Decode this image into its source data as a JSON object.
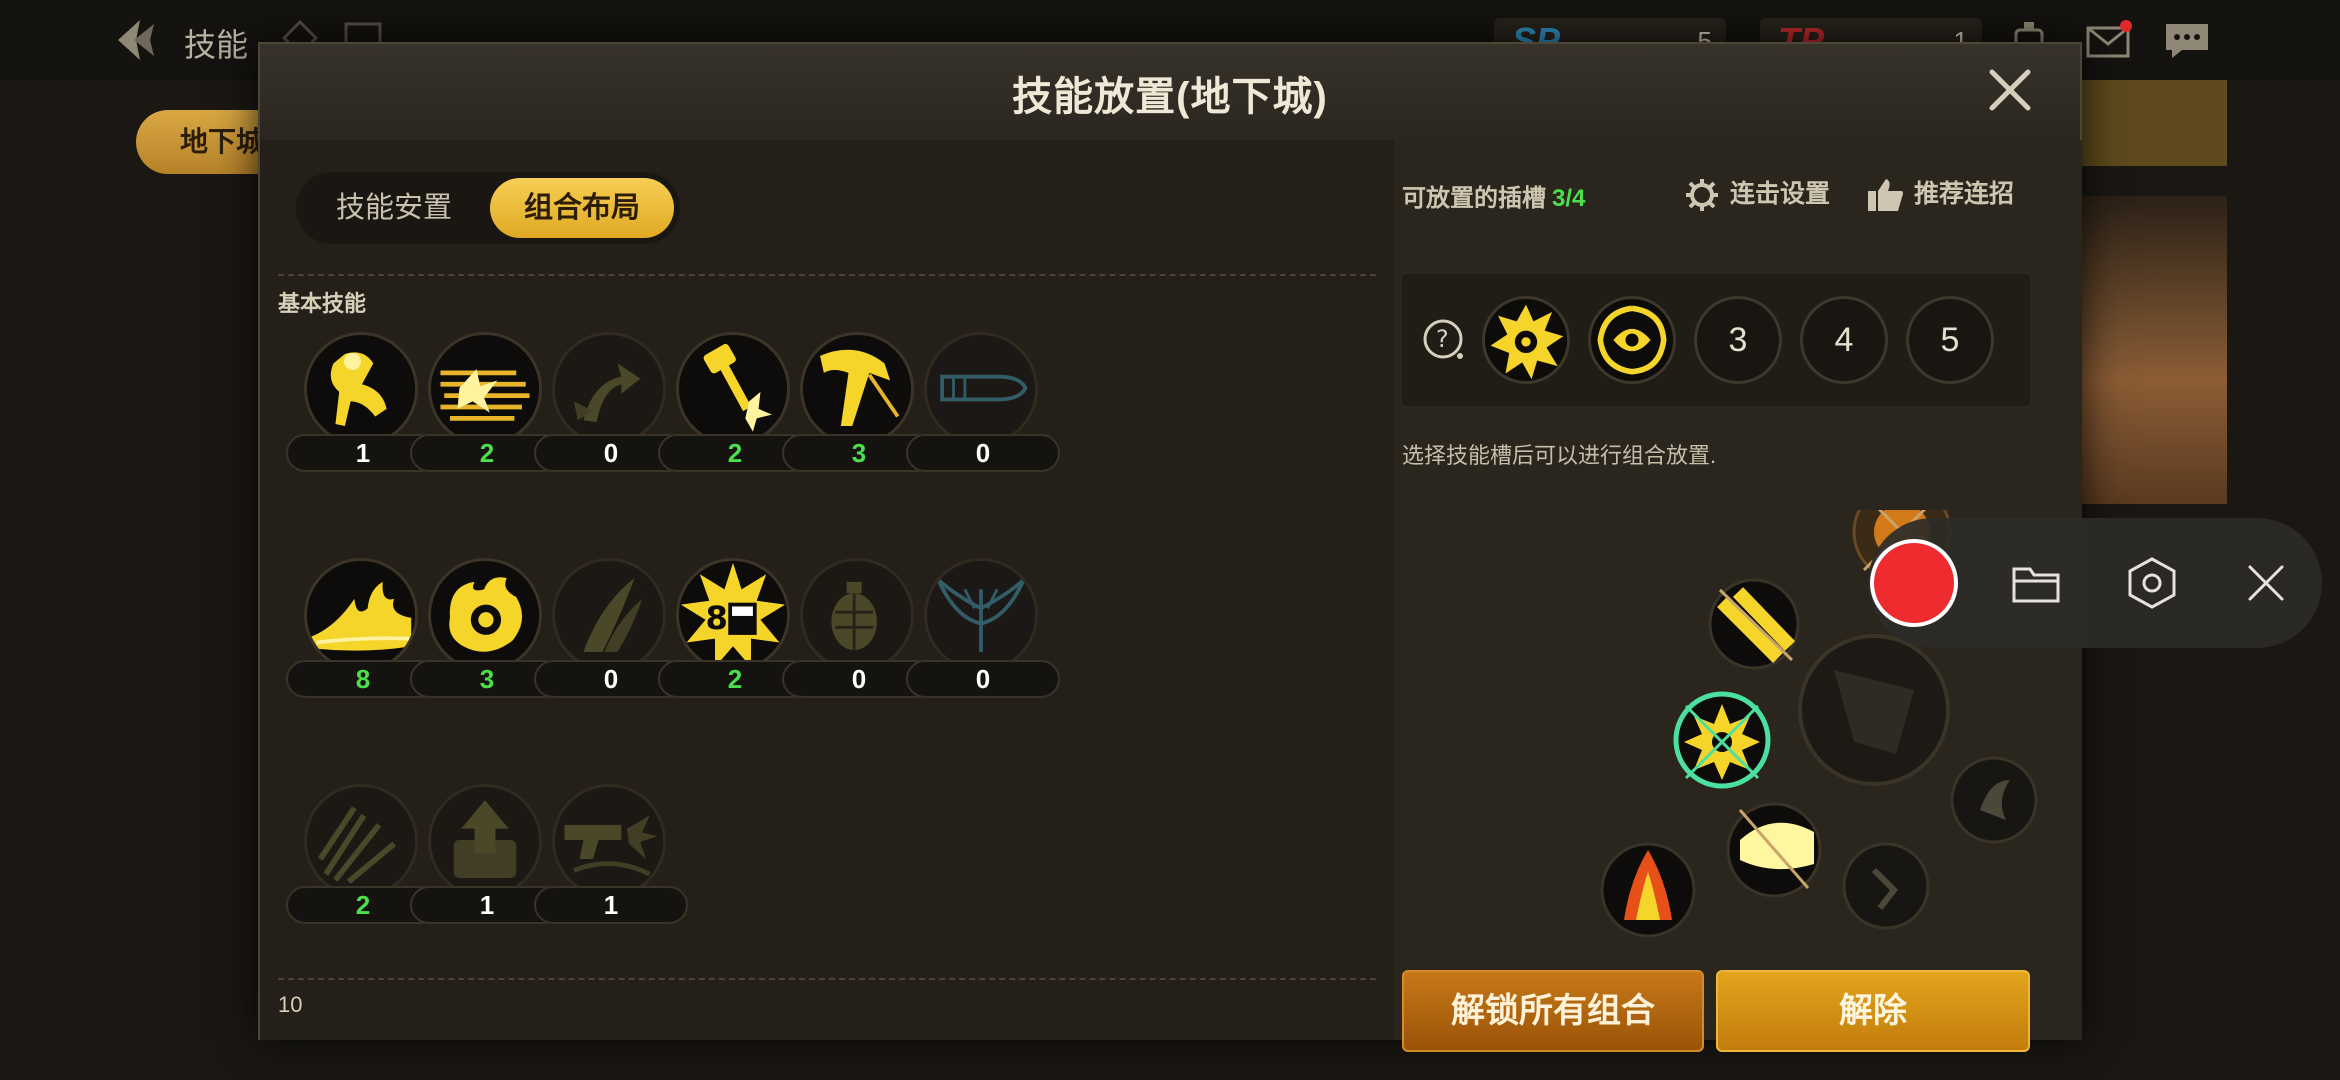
{
  "background": {
    "page_title": "技能",
    "tab_label": "地下城",
    "sp": {
      "label": "SP",
      "value": "5"
    },
    "tp": {
      "label": "TP",
      "value": "1"
    }
  },
  "dialog": {
    "title": "技能放置(地下城)",
    "tabs": [
      {
        "label": "技能安置",
        "active": false
      },
      {
        "label": "组合布局",
        "active": true
      }
    ],
    "section_label": "基本技能",
    "footer_number": "10",
    "skills": [
      {
        "count": "1",
        "count_color": "white",
        "icon": "kick-skill-icon",
        "active": true
      },
      {
        "count": "2",
        "count_color": "green",
        "icon": "dash-burst-icon",
        "active": true
      },
      {
        "count": "0",
        "count_color": "white",
        "icon": "uppercut-arrow-icon",
        "active": false
      },
      {
        "count": "2",
        "count_color": "green",
        "icon": "hammer-strike-icon",
        "active": true
      },
      {
        "count": "3",
        "count_color": "green",
        "icon": "leg-kick-icon",
        "active": true
      },
      {
        "count": "0",
        "count_color": "white",
        "icon": "bullet-icon",
        "active": false
      },
      {
        "count": "8",
        "count_color": "green",
        "icon": "fire-wave-icon",
        "active": true
      },
      {
        "count": "3",
        "count_color": "green",
        "icon": "fire-grenade-icon",
        "active": true
      },
      {
        "count": "0",
        "count_color": "white",
        "icon": "claw-slash-icon",
        "active": false
      },
      {
        "count": "2",
        "count_color": "green",
        "icon": "explosion-8-icon",
        "active": true
      },
      {
        "count": "0",
        "count_color": "white",
        "icon": "grenade-icon",
        "active": false
      },
      {
        "count": "0",
        "count_color": "white",
        "icon": "eagle-icon",
        "active": false
      },
      {
        "count": "2",
        "count_color": "green",
        "icon": "spike-burst-icon",
        "active": false
      },
      {
        "count": "1",
        "count_color": "white",
        "icon": "launch-up-icon",
        "active": false
      },
      {
        "count": "1",
        "count_color": "white",
        "icon": "gun-shot-icon",
        "active": false
      }
    ],
    "right": {
      "slots_label": "可放置的插槽",
      "slots_value": "3/4",
      "combo_settings": "连击设置",
      "recommend": "推荐连招",
      "slots": [
        {
          "type": "icon",
          "icon": "radiation-burst-icon"
        },
        {
          "type": "icon",
          "icon": "vortex-shot-icon"
        },
        {
          "type": "number",
          "label": "3"
        },
        {
          "type": "number",
          "label": "4"
        },
        {
          "type": "number",
          "label": "5"
        }
      ],
      "hint": "选择技能槽后可以进行组合放置.",
      "unlock_button": "解锁所有组合",
      "remove_button": "解除"
    }
  },
  "colors": {
    "accent_gold": "#e8b32c",
    "count_green": "#4be04b",
    "record_red": "#ee2b2e"
  }
}
